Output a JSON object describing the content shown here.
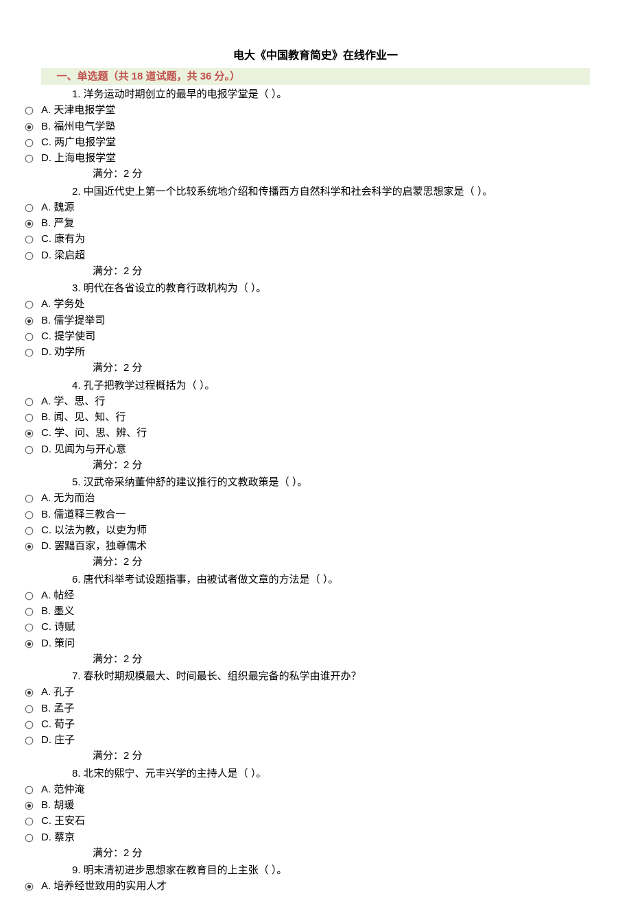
{
  "title": "电大《中国教育简史》在线作业一",
  "section_header": "一、单选题（共 18 道试题，共 36 分。）",
  "score_label": "满分：2 分",
  "questions": [
    {
      "stem": "1.  洋务运动时期创立的最早的电报学堂是（   ）。",
      "options": [
        "A.  天津电报学堂",
        "B.  福州电气学塾",
        "C.  两广电报学堂",
        "D.  上海电报学堂"
      ],
      "selected": 1
    },
    {
      "stem": "2.  中国近代史上第一个比较系统地介绍和传播西方自然科学和社会科学的启蒙思想家是（    ）。",
      "options": [
        "A.  魏源",
        "B.  严复",
        "C.  康有为",
        "D.  梁启超"
      ],
      "selected": 1
    },
    {
      "stem": "3.  明代在各省设立的教育行政机构为（   ）。",
      "options": [
        "A.  学务处",
        "B.  儒学提举司",
        "C.  提学使司",
        "D.  劝学所"
      ],
      "selected": 1
    },
    {
      "stem": "4.  孔子把教学过程概括为（    ）。",
      "options": [
        "A.  学、思、行",
        "B.  闻、见、知、行",
        "C.  学、问、思、辨、行",
        "D.  见闻为与开心意"
      ],
      "selected": 2
    },
    {
      "stem": "5.  汉武帝采纳董仲舒的建议推行的文教政策是（    ）。",
      "options": [
        "A.  无为而治",
        "B.  儒道释三教合一",
        "C.  以法为教，以吏为师",
        "D.  罢黜百家，独尊儒术"
      ],
      "selected": 3
    },
    {
      "stem": "6.  唐代科举考试设题指事，由被试者做文章的方法是（    ）。",
      "options": [
        "A.  帖经",
        "B.  墨义",
        "C.  诗赋",
        "D.  策问"
      ],
      "selected": 3
    },
    {
      "stem": "7.  春秋时期规模最大、时间最长、组织最完备的私学由谁开办？",
      "options": [
        "A.  孔子",
        "B.  孟子",
        "C.  荀子",
        "D.  庄子"
      ],
      "selected": 0
    },
    {
      "stem": "8.  北宋的熙宁、元丰兴学的主持人是（   ）。",
      "options": [
        "A.  范仲淹",
        "B.  胡瑗",
        "C.  王安石",
        "D.  蔡京"
      ],
      "selected": 1
    },
    {
      "stem": "9.  明末清初进步思想家在教育目的上主张（    ）。",
      "options": [
        "A.  培养经世致用的实用人才"
      ],
      "selected": 0,
      "no_score": true
    }
  ]
}
